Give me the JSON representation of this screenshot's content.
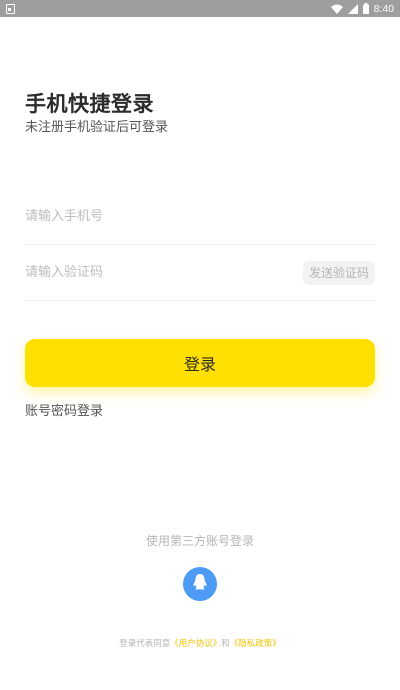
{
  "status_bar": {
    "time": "8:40",
    "icons": [
      "sim-icon",
      "wifi-icon",
      "signal-icon",
      "battery-icon"
    ]
  },
  "header": {
    "title": "手机快捷登录",
    "subtitle": "未注册手机验证后可登录"
  },
  "form": {
    "phone_placeholder": "请输入手机号",
    "code_placeholder": "请输入验证码",
    "send_code_label": "发送验证码",
    "login_label": "登录",
    "password_login_label": "账号密码登录"
  },
  "third_party": {
    "label": "使用第三方账号登录",
    "icon": "qq-icon"
  },
  "agreement": {
    "prefix": "登录代表同意",
    "user_agreement": "《用户协议》",
    "and": "和",
    "privacy_policy": "《隐私政策》"
  },
  "colors": {
    "accent": "#ffe000",
    "link": "#f2c300",
    "qq": "#4d9bf5",
    "status_bar": "#9e9e9e"
  }
}
